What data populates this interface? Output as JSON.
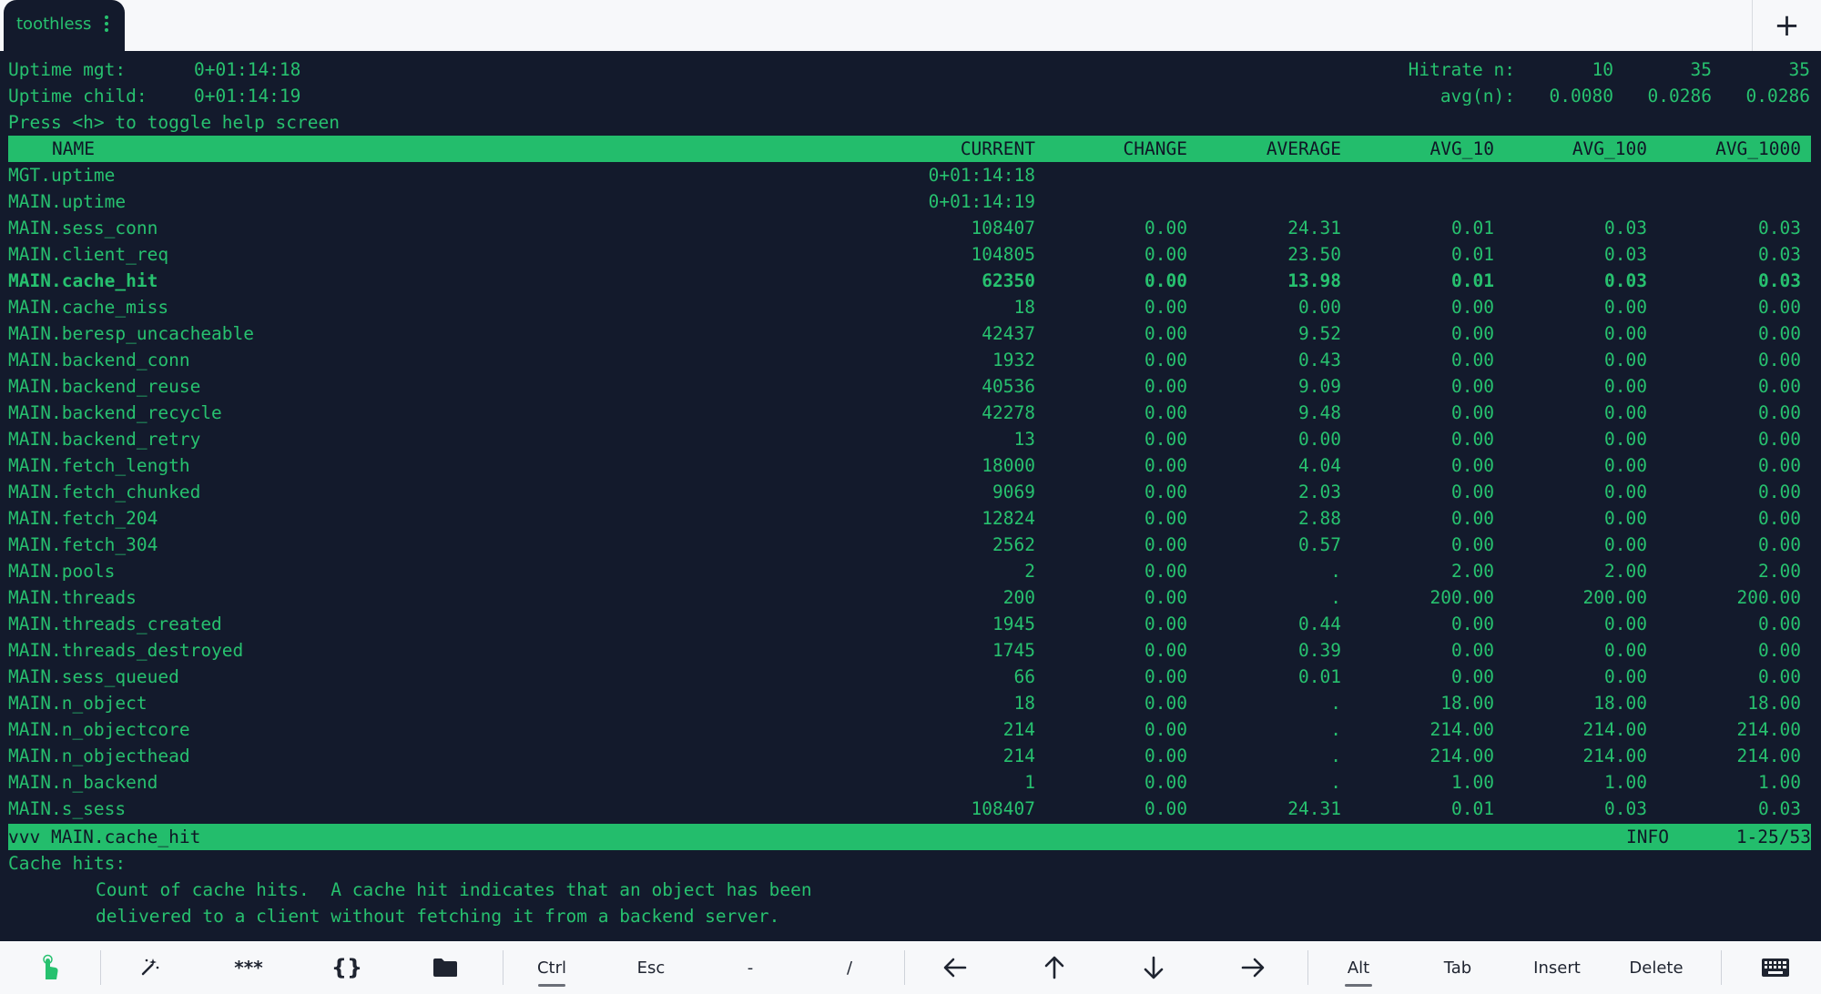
{
  "tab": {
    "title": "toothless"
  },
  "header": {
    "uptime_mgt_label": "Uptime mgt:",
    "uptime_mgt_value": "0+01:14:18",
    "uptime_child_label": "Uptime child:",
    "uptime_child_value": "0+01:14:19",
    "help_hint": "Press <h> to toggle help screen",
    "hitrate_label": "Hitrate n:",
    "hitrate_n": [
      "10",
      "35",
      "35"
    ],
    "avg_label": "avg(n):",
    "avg_values": [
      "0.0080",
      "0.0286",
      "0.0286"
    ]
  },
  "table": {
    "columns": [
      "NAME",
      "CURRENT",
      "CHANGE",
      "AVERAGE",
      "AVG_10",
      "AVG_100",
      "AVG_1000"
    ],
    "rows": [
      [
        "MGT.uptime",
        "0+01:14:18",
        "",
        "",
        "",
        "",
        ""
      ],
      [
        "MAIN.uptime",
        "0+01:14:19",
        "",
        "",
        "",
        "",
        ""
      ],
      [
        "MAIN.sess_conn",
        "108407",
        "0.00",
        "24.31",
        "0.01",
        "0.03",
        "0.03"
      ],
      [
        "MAIN.client_req",
        "104805",
        "0.00",
        "23.50",
        "0.01",
        "0.03",
        "0.03"
      ],
      [
        "MAIN.cache_hit",
        "62350",
        "0.00",
        "13.98",
        "0.01",
        "0.03",
        "0.03"
      ],
      [
        "MAIN.cache_miss",
        "18",
        "0.00",
        "0.00",
        "0.00",
        "0.00",
        "0.00"
      ],
      [
        "MAIN.beresp_uncacheable",
        "42437",
        "0.00",
        "9.52",
        "0.00",
        "0.00",
        "0.00"
      ],
      [
        "MAIN.backend_conn",
        "1932",
        "0.00",
        "0.43",
        "0.00",
        "0.00",
        "0.00"
      ],
      [
        "MAIN.backend_reuse",
        "40536",
        "0.00",
        "9.09",
        "0.00",
        "0.00",
        "0.00"
      ],
      [
        "MAIN.backend_recycle",
        "42278",
        "0.00",
        "9.48",
        "0.00",
        "0.00",
        "0.00"
      ],
      [
        "MAIN.backend_retry",
        "13",
        "0.00",
        "0.00",
        "0.00",
        "0.00",
        "0.00"
      ],
      [
        "MAIN.fetch_length",
        "18000",
        "0.00",
        "4.04",
        "0.00",
        "0.00",
        "0.00"
      ],
      [
        "MAIN.fetch_chunked",
        "9069",
        "0.00",
        "2.03",
        "0.00",
        "0.00",
        "0.00"
      ],
      [
        "MAIN.fetch_204",
        "12824",
        "0.00",
        "2.88",
        "0.00",
        "0.00",
        "0.00"
      ],
      [
        "MAIN.fetch_304",
        "2562",
        "0.00",
        "0.57",
        "0.00",
        "0.00",
        "0.00"
      ],
      [
        "MAIN.pools",
        "2",
        "0.00",
        ".",
        "2.00",
        "2.00",
        "2.00"
      ],
      [
        "MAIN.threads",
        "200",
        "0.00",
        ".",
        "200.00",
        "200.00",
        "200.00"
      ],
      [
        "MAIN.threads_created",
        "1945",
        "0.00",
        "0.44",
        "0.00",
        "0.00",
        "0.00"
      ],
      [
        "MAIN.threads_destroyed",
        "1745",
        "0.00",
        "0.39",
        "0.00",
        "0.00",
        "0.00"
      ],
      [
        "MAIN.sess_queued",
        "66",
        "0.00",
        "0.01",
        "0.00",
        "0.00",
        "0.00"
      ],
      [
        "MAIN.n_object",
        "18",
        "0.00",
        ".",
        "18.00",
        "18.00",
        "18.00"
      ],
      [
        "MAIN.n_objectcore",
        "214",
        "0.00",
        ".",
        "214.00",
        "214.00",
        "214.00"
      ],
      [
        "MAIN.n_objecthead",
        "214",
        "0.00",
        ".",
        "214.00",
        "214.00",
        "214.00"
      ],
      [
        "MAIN.n_backend",
        "1",
        "0.00",
        ".",
        "1.00",
        "1.00",
        "1.00"
      ],
      [
        "MAIN.s_sess",
        "108407",
        "0.00",
        "24.31",
        "0.01",
        "0.03",
        "0.03"
      ]
    ],
    "selected_row": 4
  },
  "status": {
    "left": "vvv MAIN.cache_hit",
    "level": "INFO",
    "position": "1-25/53"
  },
  "description": {
    "title": "Cache hits:",
    "line1": "Count of cache hits.  A cache hit indicates that an object has been",
    "line2": "delivered to a client without fetching it from a backend server."
  },
  "keybar": {
    "ctrl": "Ctrl",
    "esc": "Esc",
    "dash": "-",
    "slash": "/",
    "alt": "Alt",
    "tab": "Tab",
    "insert": "Insert",
    "delete": "Delete",
    "stars": "***",
    "braces": "{}"
  },
  "colors": {
    "terminal_bg": "#131a2c",
    "terminal_fg": "#27c16f",
    "highlight_bar": "#23bd6c",
    "chrome_bg": "#f7f8fa"
  },
  "icons": [
    "touch-icon",
    "magic-wand-icon",
    "folder-icon",
    "arrow-left-icon",
    "arrow-up-icon",
    "arrow-down-icon",
    "arrow-right-icon",
    "keyboard-icon",
    "kebab-menu-icon",
    "plus-icon"
  ]
}
